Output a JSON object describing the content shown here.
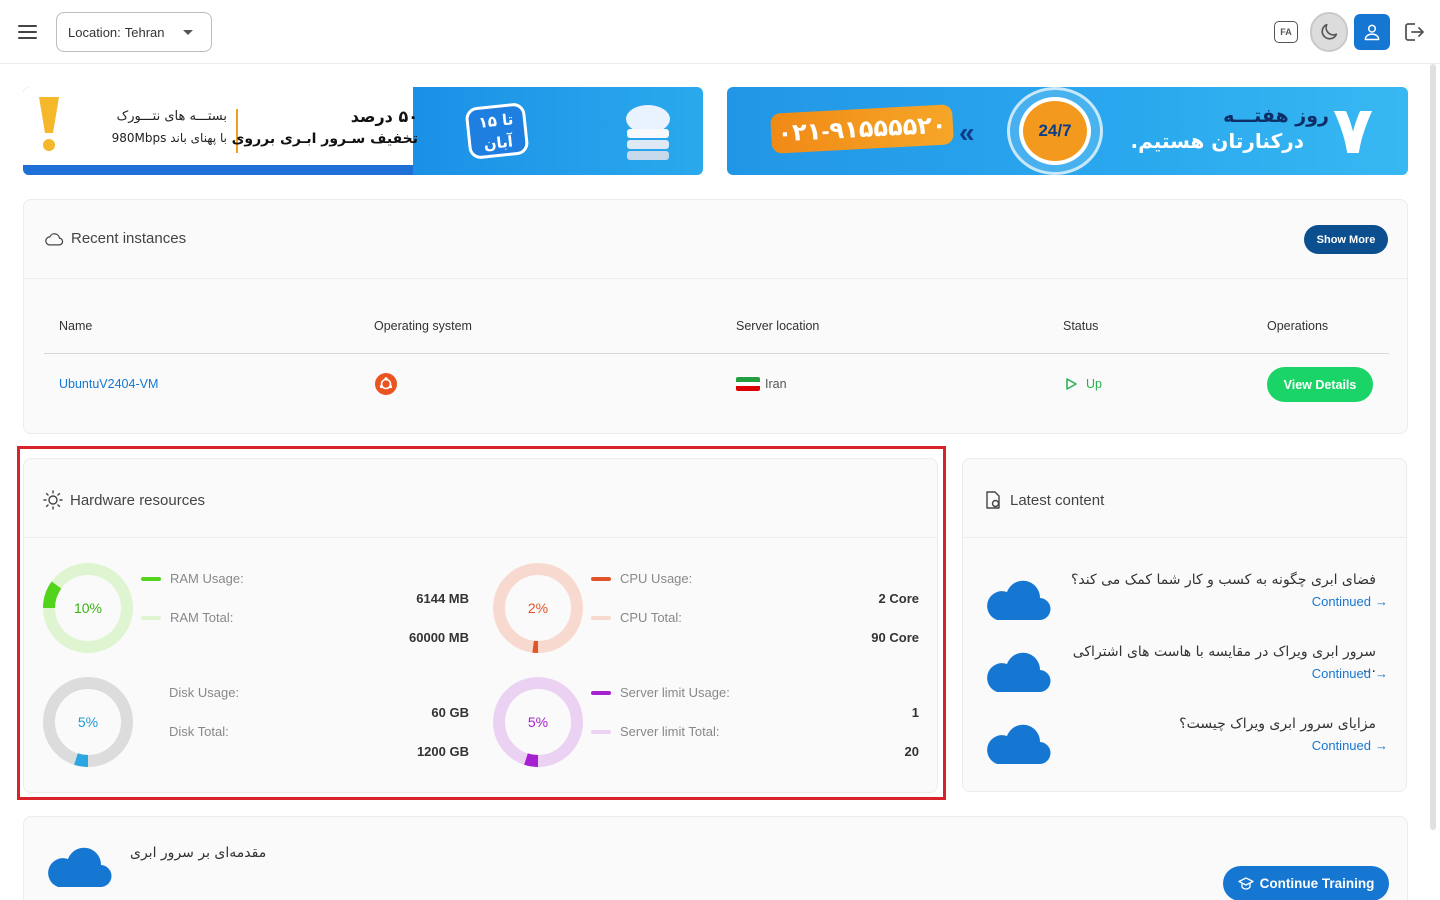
{
  "topbar": {
    "location_label": "Location:",
    "location_value": "Tehran",
    "lang_badge": "FA",
    "icons": [
      "menu-icon",
      "chevron-down-icon",
      "moon-icon",
      "user-icon",
      "logout-icon"
    ]
  },
  "banners": {
    "left": {
      "line1": "بستـــه های نتـــورک",
      "line2": "با پهنای باند 980Mbps",
      "line3": "۵۰ درصد",
      "line4": "تخفیف سـرور ابـری برروی",
      "badge": "تا ۱۵ آبان"
    },
    "right": {
      "phone": "۰۲۱-۹۱۵۵۵۵۲۰",
      "support": "24/7",
      "line1": "روز هفتـــه",
      "line2": "درکنارتان هستیم.",
      "big_number": "۷"
    }
  },
  "recent": {
    "title": "Recent instances",
    "show_more": "Show More",
    "columns": [
      "Name",
      "Operating system",
      "Server location",
      "Status",
      "Operations"
    ],
    "rows": [
      {
        "name": "UbuntuV2404-VM",
        "os": "ubuntu",
        "location": "Iran",
        "status": "Up",
        "action": "View Details"
      }
    ]
  },
  "hardware": {
    "title": "Hardware resources",
    "ram": {
      "percent": "10%",
      "fraction": 0.1,
      "usage_label": "RAM Usage:",
      "total_label": "RAM Total:",
      "usage": "6144 MB",
      "total": "60000 MB",
      "color": "#52d41b",
      "track": "#dff5d2",
      "text_color": "#3ab512"
    },
    "cpu": {
      "percent": "2%",
      "fraction": 0.02,
      "usage_label": "CPU Usage:",
      "total_label": "CPU Total:",
      "usage": "2 Core",
      "total": "90 Core",
      "color": "#e2532a",
      "track": "#f7d9cf",
      "text_color": "#e2532a"
    },
    "disk": {
      "percent": "5%",
      "fraction": 0.05,
      "usage_label": "Disk Usage:",
      "total_label": "Disk Total:",
      "usage": "60 GB",
      "total": "1200 GB",
      "color": "#2aa7e0",
      "track": "#dcdcdc",
      "text_color": "#1f9ad6"
    },
    "server": {
      "percent": "5%",
      "fraction": 0.05,
      "usage_label": "Server limit Usage:",
      "total_label": "Server limit Total:",
      "usage": "1",
      "total": "20",
      "color": "#a61fd0",
      "track": "#ecd2f2",
      "text_color": "#a61fd0"
    }
  },
  "latest": {
    "title": "Latest content",
    "articles": [
      {
        "title": "فضای ابری چگونه به کسب و کار شما کمک می کند؟",
        "more": "Continued"
      },
      {
        "title": "سرور ابری ویراک در مقایسه با هاست های اشتراکی ...",
        "more": "Continued"
      },
      {
        "title": "مزایای سرور ابری ویراک چیست؟",
        "more": "Continued"
      }
    ]
  },
  "training": {
    "title": "مقدمه‌ای بر سرور ابری",
    "button": "Continue Training"
  }
}
